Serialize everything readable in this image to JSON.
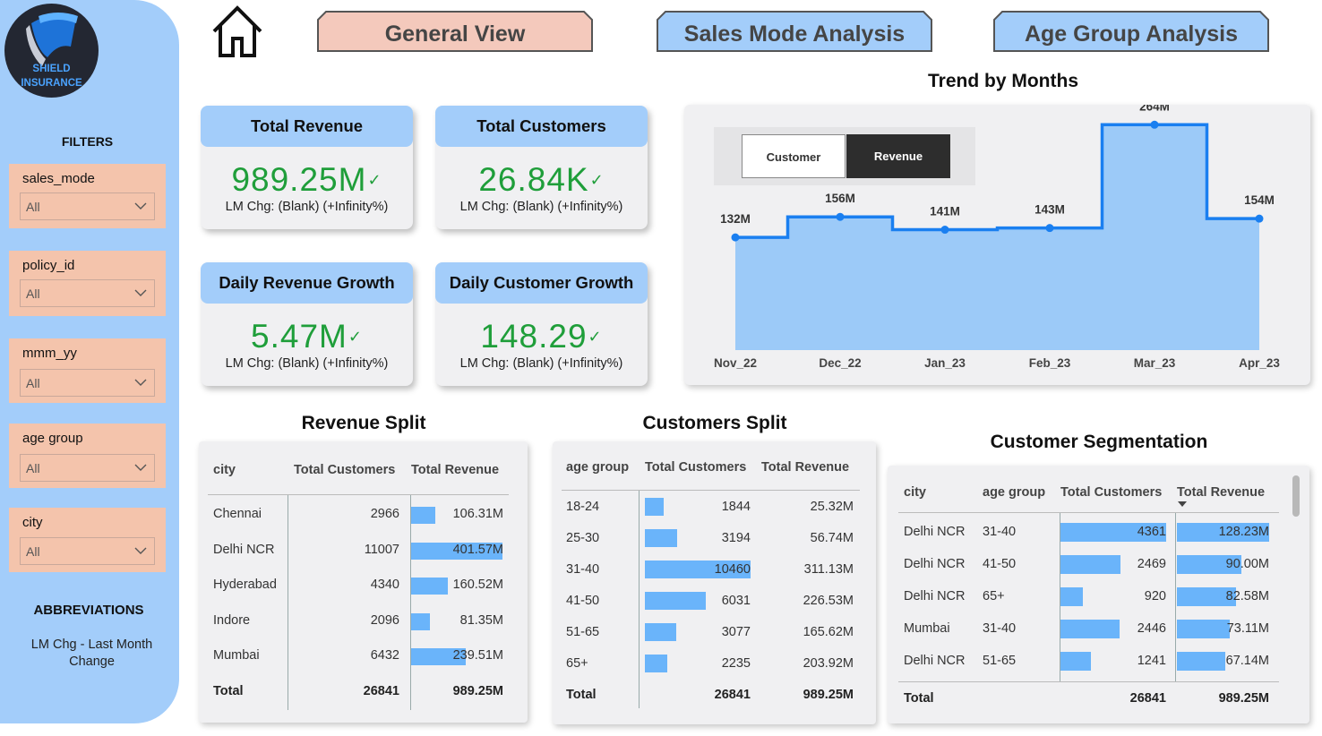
{
  "logo": {
    "line1": "SHIELD",
    "line2": "INSURANCE"
  },
  "nav": {
    "general_view": "General View",
    "sales_mode": "Sales Mode Analysis",
    "age_group": "Age Group Analysis",
    "colors": {
      "active": "#f4c9bc",
      "inactive": "#a3cdfa"
    }
  },
  "sidebar": {
    "filters_title": "FILTERS",
    "filters": [
      {
        "label": "sales_mode",
        "value": "All"
      },
      {
        "label": "policy_id",
        "value": "All"
      },
      {
        "label": "mmm_yy",
        "value": "All"
      },
      {
        "label": "age group",
        "value": "All"
      },
      {
        "label": "city",
        "value": "All"
      }
    ],
    "abbr_title": "ABBREVIATIONS",
    "abbr_text": "LM Chg - Last Month Change"
  },
  "kpis": [
    {
      "title": "Total Revenue",
      "value": "989.25M",
      "sub": "LM Chg: (Blank) (+Infinity%)"
    },
    {
      "title": "Total Customers",
      "value": "26.84K",
      "sub": "LM Chg: (Blank) (+Infinity%)"
    },
    {
      "title": "Daily Revenue Growth",
      "value": "5.47M",
      "sub": "LM Chg: (Blank) (+Infinity%)"
    },
    {
      "title": "Daily Customer Growth",
      "value": "148.29",
      "sub": "LM Chg: (Blank) (+Infinity%)"
    }
  ],
  "kpi_check": "✓",
  "trend": {
    "title": "Trend by Months",
    "toggle": {
      "customer": "Customer",
      "revenue": "Revenue",
      "selected": "Revenue"
    }
  },
  "chart_data": {
    "type": "area",
    "title": "Trend by Months",
    "x": [
      "Nov_22",
      "Dec_22",
      "Jan_23",
      "Feb_23",
      "Mar_23",
      "Apr_23"
    ],
    "values": [
      132,
      156,
      141,
      143,
      264,
      154
    ],
    "data_labels": [
      "132M",
      "156M",
      "141M",
      "143M",
      "264M",
      "154M"
    ],
    "unit": "M",
    "step": true,
    "colors": {
      "line": "#1a7ff0",
      "fill": "#9ccaf8"
    }
  },
  "revenue_split": {
    "title": "Revenue Split",
    "headers": [
      "city",
      "Total Customers",
      "Total Revenue"
    ],
    "rows": [
      {
        "name": "Chennai",
        "customers": "2966",
        "revenue": "106.31M",
        "rev_value": 106.31
      },
      {
        "name": "Delhi NCR",
        "customers": "11007",
        "revenue": "401.57M",
        "rev_value": 401.57
      },
      {
        "name": "Hyderabad",
        "customers": "4340",
        "revenue": "160.52M",
        "rev_value": 160.52
      },
      {
        "name": "Indore",
        "customers": "2096",
        "revenue": "81.35M",
        "rev_value": 81.35
      },
      {
        "name": "Mumbai",
        "customers": "6432",
        "revenue": "239.51M",
        "rev_value": 239.51
      }
    ],
    "total": {
      "label": "Total",
      "customers": "26841",
      "revenue": "989.25M"
    }
  },
  "customers_split": {
    "title": "Customers Split",
    "headers": [
      "age group",
      "Total Customers",
      "Total Revenue"
    ],
    "rows": [
      {
        "name": "18-24",
        "customers": "1844",
        "revenue": "25.32M",
        "cust_value": 1844
      },
      {
        "name": "25-30",
        "customers": "3194",
        "revenue": "56.74M",
        "cust_value": 3194
      },
      {
        "name": "31-40",
        "customers": "10460",
        "revenue": "311.13M",
        "cust_value": 10460
      },
      {
        "name": "41-50",
        "customers": "6031",
        "revenue": "226.53M",
        "cust_value": 6031
      },
      {
        "name": "51-65",
        "customers": "3077",
        "revenue": "165.62M",
        "cust_value": 3077
      },
      {
        "name": "65+",
        "customers": "2235",
        "revenue": "203.92M",
        "cust_value": 2235
      }
    ],
    "total": {
      "label": "Total",
      "customers": "26841",
      "revenue": "989.25M"
    }
  },
  "segmentation": {
    "title": "Customer Segmentation",
    "headers": [
      "city",
      "age group",
      "Total Customers",
      "Total Revenue"
    ],
    "rows": [
      {
        "city": "Delhi NCR",
        "age": "31-40",
        "customers": "4361",
        "revenue": "128.23M",
        "cust_value": 4361,
        "rev_value": 128.23
      },
      {
        "city": "Delhi NCR",
        "age": "41-50",
        "customers": "2469",
        "revenue": "90.00M",
        "cust_value": 2469,
        "rev_value": 90.0
      },
      {
        "city": "Delhi NCR",
        "age": "65+",
        "customers": "920",
        "revenue": "82.58M",
        "cust_value": 920,
        "rev_value": 82.58
      },
      {
        "city": "Mumbai",
        "age": "31-40",
        "customers": "2446",
        "revenue": "73.11M",
        "cust_value": 2446,
        "rev_value": 73.11
      },
      {
        "city": "Delhi NCR",
        "age": "51-65",
        "customers": "1241",
        "revenue": "67.14M",
        "cust_value": 1241,
        "rev_value": 67.14
      }
    ],
    "total": {
      "label": "Total",
      "customers": "26841",
      "revenue": "989.25M"
    }
  }
}
